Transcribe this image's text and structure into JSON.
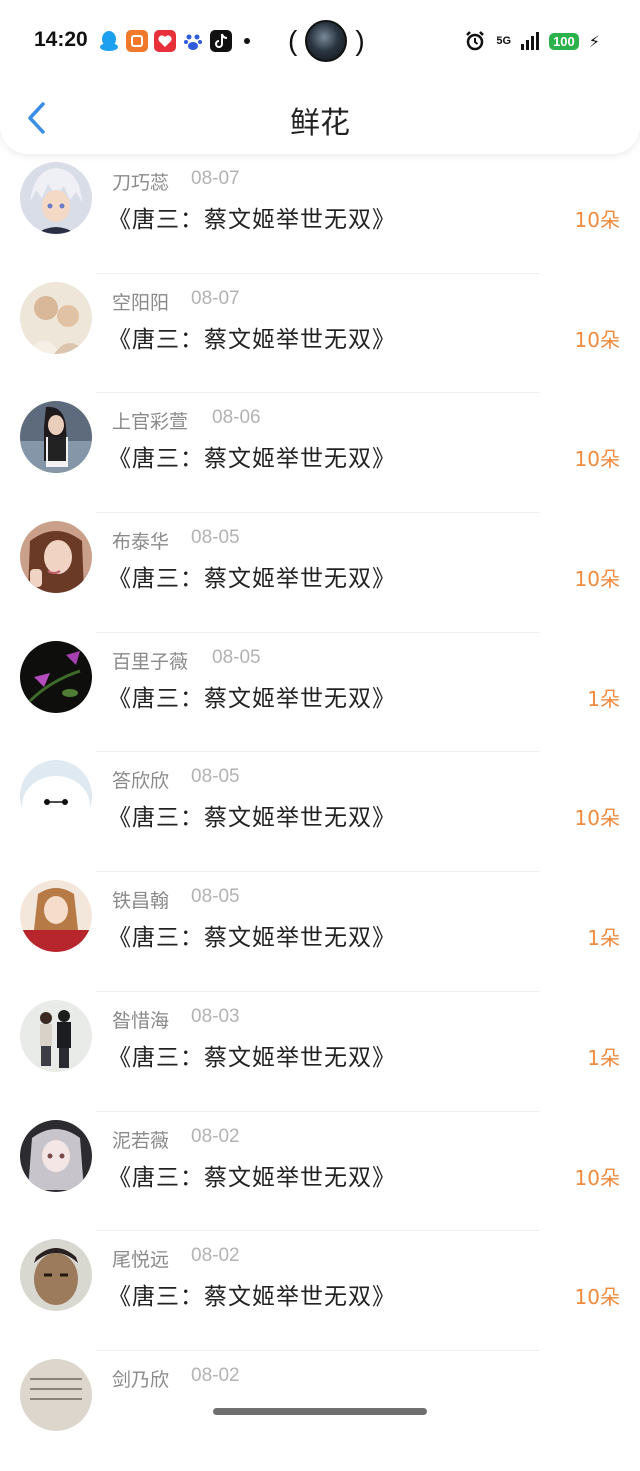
{
  "status_bar": {
    "time": "14:20",
    "network": "5G",
    "battery": "100",
    "app_icons": [
      "qq-icon",
      "orange-app-icon",
      "red-app-icon",
      "baidu-icon",
      "tiktok-icon"
    ]
  },
  "header": {
    "title": "鲜花"
  },
  "colors": {
    "accent_blue": "#3a8ee6",
    "amount_orange": "#f08a3c",
    "name_gray": "#8a8a8a",
    "date_gray": "#b3b3b3"
  },
  "records": [
    {
      "name": "刀巧蕊",
      "date": "08-07",
      "book": "《唐三：蔡文姬举世无双》",
      "amount": "10朵",
      "avatar": "anime-boy-avatar"
    },
    {
      "name": "空阳阳",
      "date": "08-07",
      "book": "《唐三：蔡文姬举世无双》",
      "amount": "10朵",
      "avatar": "couple-avatar"
    },
    {
      "name": "上官彩萱",
      "date": "08-06",
      "book": "《唐三：蔡文姬举世无双》",
      "amount": "10朵",
      "avatar": "girl-seaside-avatar"
    },
    {
      "name": "布泰华",
      "date": "08-05",
      "book": "《唐三：蔡文姬举世无双》",
      "amount": "10朵",
      "avatar": "girl-selfie-avatar"
    },
    {
      "name": "百里子薇",
      "date": "08-05",
      "book": "《唐三：蔡文姬举世无双》",
      "amount": "1朵",
      "avatar": "purple-flower-avatar"
    },
    {
      "name": "答欣欣",
      "date": "08-05",
      "book": "《唐三：蔡文姬举世无双》",
      "amount": "10朵",
      "avatar": "baymax-avatar"
    },
    {
      "name": "铁昌翰",
      "date": "08-05",
      "book": "《唐三：蔡文姬举世无双》",
      "amount": "1朵",
      "avatar": "girl-banner-avatar"
    },
    {
      "name": "昝惜海",
      "date": "08-03",
      "book": "《唐三：蔡文姬举世无双》",
      "amount": "1朵",
      "avatar": "couple-standing-avatar"
    },
    {
      "name": "泥若薇",
      "date": "08-02",
      "book": "《唐三：蔡文姬举世无双》",
      "amount": "10朵",
      "avatar": "anime-girl-avatar"
    },
    {
      "name": "尾悦远",
      "date": "08-02",
      "book": "《唐三：蔡文姬举世无双》",
      "amount": "10朵",
      "avatar": "man-face-avatar"
    },
    {
      "name": "剑乃欣",
      "date": "08-02",
      "book": "",
      "amount": "",
      "avatar": "text-photo-avatar"
    }
  ]
}
